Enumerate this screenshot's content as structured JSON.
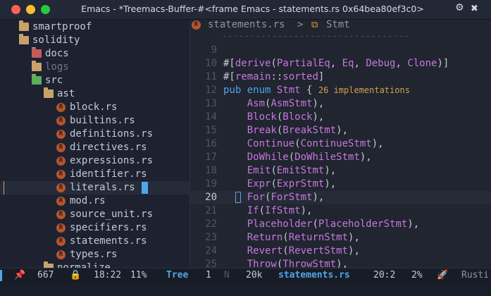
{
  "window": {
    "title": "Emacs - *Treemacs-Buffer-#<frame Emacs - statements.rs 0x64bea80ef3c0>"
  },
  "treemacs": {
    "items": [
      {
        "label": "smartproof",
        "type": "folder",
        "color": "#c9a26a",
        "text_color": "#c3cbd8"
      },
      {
        "label": "solidity",
        "type": "folder",
        "color": "#c9a26a",
        "text_color": "#c3cbd8"
      },
      {
        "label": "docs",
        "type": "folder",
        "color": "#c45c5c",
        "text_color": "#c3cbd8"
      },
      {
        "label": "logs",
        "type": "folder",
        "color": "#c9a26a",
        "text_color": "#6b7a90"
      },
      {
        "label": "src",
        "type": "folder",
        "color": "#5cae5c",
        "text_color": "#c3cbd8"
      },
      {
        "label": "ast",
        "type": "folder",
        "color": "#c9a26a",
        "text_color": "#c3cbd8"
      },
      {
        "label": "block.rs",
        "type": "rust-file",
        "text_color": "#c3cbd8"
      },
      {
        "label": "builtins.rs",
        "type": "rust-file",
        "text_color": "#c3cbd8"
      },
      {
        "label": "definitions.rs",
        "type": "rust-file",
        "text_color": "#c3cbd8"
      },
      {
        "label": "directives.rs",
        "type": "rust-file",
        "text_color": "#c3cbd8"
      },
      {
        "label": "expressions.rs",
        "type": "rust-file",
        "text_color": "#c3cbd8"
      },
      {
        "label": "identifier.rs",
        "type": "rust-file",
        "text_color": "#c3cbd8"
      },
      {
        "label": "literals.rs",
        "type": "rust-file",
        "text_color": "#c3cbd8"
      },
      {
        "label": "mod.rs",
        "type": "rust-file",
        "text_color": "#c3cbd8"
      },
      {
        "label": "source_unit.rs",
        "type": "rust-file",
        "text_color": "#c3cbd8"
      },
      {
        "label": "specifiers.rs",
        "type": "rust-file",
        "text_color": "#c3cbd8"
      },
      {
        "label": "statements.rs",
        "type": "rust-file",
        "text_color": "#c3cbd8"
      },
      {
        "label": "types.rs",
        "type": "rust-file",
        "text_color": "#c3cbd8"
      },
      {
        "label": "normalize",
        "type": "folder",
        "color": "#c9a26a",
        "text_color": "#c3cbd8"
      }
    ]
  },
  "editor": {
    "breadcrumb_file": "statements.rs",
    "breadcrumb_sep": ">",
    "breadcrumb_symbol": "Stmt",
    "dashes": "----------------------------------",
    "lines": [
      {
        "num": "9",
        "parts": []
      },
      {
        "num": "10",
        "parts": [
          {
            "t": "#[",
            "c": "#c3cbd8"
          },
          {
            "t": "derive",
            "c": "#c678dd"
          },
          {
            "t": "(",
            "c": "#c3cbd8"
          },
          {
            "t": "PartialEq",
            "c": "#c678dd"
          },
          {
            "t": ", ",
            "c": "#c3cbd8"
          },
          {
            "t": "Eq",
            "c": "#c678dd"
          },
          {
            "t": ", ",
            "c": "#c3cbd8"
          },
          {
            "t": "Debug",
            "c": "#c678dd"
          },
          {
            "t": ", ",
            "c": "#c3cbd8"
          },
          {
            "t": "Clone",
            "c": "#c678dd"
          },
          {
            "t": ")]",
            "c": "#c3cbd8"
          }
        ]
      },
      {
        "num": "11",
        "parts": [
          {
            "t": "#[",
            "c": "#c3cbd8"
          },
          {
            "t": "remain",
            "c": "#c678dd"
          },
          {
            "t": "::",
            "c": "#c3cbd8"
          },
          {
            "t": "sorted",
            "c": "#c678dd"
          },
          {
            "t": "]",
            "c": "#c3cbd8"
          }
        ]
      },
      {
        "num": "12",
        "parts": [
          {
            "t": "pub ",
            "c": "#4fa6e8"
          },
          {
            "t": "enum ",
            "c": "#4fa6e8"
          },
          {
            "t": "Stmt",
            "c": "#c678dd"
          },
          {
            "t": " { ",
            "c": "#c3cbd8"
          },
          {
            "t": "26 implementations",
            "c": "#d1a14e",
            "small": true
          }
        ]
      },
      {
        "num": "13",
        "parts": [
          {
            "t": "    Asm",
            "c": "#c678dd"
          },
          {
            "t": "(",
            "c": "#c3cbd8"
          },
          {
            "t": "AsmStmt",
            "c": "#c678dd"
          },
          {
            "t": "),",
            "c": "#c3cbd8"
          }
        ]
      },
      {
        "num": "14",
        "parts": [
          {
            "t": "    Block",
            "c": "#c678dd"
          },
          {
            "t": "(",
            "c": "#c3cbd8"
          },
          {
            "t": "Block",
            "c": "#c678dd"
          },
          {
            "t": "),",
            "c": "#c3cbd8"
          }
        ]
      },
      {
        "num": "15",
        "parts": [
          {
            "t": "    Break",
            "c": "#c678dd"
          },
          {
            "t": "(",
            "c": "#c3cbd8"
          },
          {
            "t": "BreakStmt",
            "c": "#c678dd"
          },
          {
            "t": "),",
            "c": "#c3cbd8"
          }
        ]
      },
      {
        "num": "16",
        "parts": [
          {
            "t": "    Continue",
            "c": "#c678dd"
          },
          {
            "t": "(",
            "c": "#c3cbd8"
          },
          {
            "t": "ContinueStmt",
            "c": "#c678dd"
          },
          {
            "t": "),",
            "c": "#c3cbd8"
          }
        ]
      },
      {
        "num": "17",
        "parts": [
          {
            "t": "    DoWhile",
            "c": "#c678dd"
          },
          {
            "t": "(",
            "c": "#c3cbd8"
          },
          {
            "t": "DoWhileStmt",
            "c": "#c678dd"
          },
          {
            "t": "),",
            "c": "#c3cbd8"
          }
        ]
      },
      {
        "num": "18",
        "parts": [
          {
            "t": "    Emit",
            "c": "#c678dd"
          },
          {
            "t": "(",
            "c": "#c3cbd8"
          },
          {
            "t": "EmitStmt",
            "c": "#c678dd"
          },
          {
            "t": "),",
            "c": "#c3cbd8"
          }
        ]
      },
      {
        "num": "19",
        "parts": [
          {
            "t": "    Expr",
            "c": "#c678dd"
          },
          {
            "t": "(",
            "c": "#c3cbd8"
          },
          {
            "t": "ExprStmt",
            "c": "#c678dd"
          },
          {
            "t": "),",
            "c": "#c3cbd8"
          }
        ]
      },
      {
        "num": "20",
        "current": true,
        "parts": [
          {
            "t": "    For",
            "c": "#c678dd"
          },
          {
            "t": "(",
            "c": "#c3cbd8"
          },
          {
            "t": "ForStmt",
            "c": "#c678dd"
          },
          {
            "t": "),",
            "c": "#c3cbd8"
          }
        ]
      },
      {
        "num": "21",
        "parts": [
          {
            "t": "    If",
            "c": "#c678dd"
          },
          {
            "t": "(",
            "c": "#c3cbd8"
          },
          {
            "t": "IfStmt",
            "c": "#c678dd"
          },
          {
            "t": "),",
            "c": "#c3cbd8"
          }
        ]
      },
      {
        "num": "22",
        "parts": [
          {
            "t": "    Placeholder",
            "c": "#c678dd"
          },
          {
            "t": "(",
            "c": "#c3cbd8"
          },
          {
            "t": "PlaceholderStmt",
            "c": "#c678dd"
          },
          {
            "t": "),",
            "c": "#c3cbd8"
          }
        ]
      },
      {
        "num": "23",
        "parts": [
          {
            "t": "    Return",
            "c": "#c678dd"
          },
          {
            "t": "(",
            "c": "#c3cbd8"
          },
          {
            "t": "ReturnStmt",
            "c": "#c678dd"
          },
          {
            "t": "),",
            "c": "#c3cbd8"
          }
        ]
      },
      {
        "num": "24",
        "parts": [
          {
            "t": "    Revert",
            "c": "#c678dd"
          },
          {
            "t": "(",
            "c": "#c3cbd8"
          },
          {
            "t": "RevertStmt",
            "c": "#c678dd"
          },
          {
            "t": "),",
            "c": "#c3cbd8"
          }
        ]
      },
      {
        "num": "25",
        "parts": [
          {
            "t": "    Throw",
            "c": "#c678dd"
          },
          {
            "t": "(",
            "c": "#c3cbd8"
          },
          {
            "t": "ThrowStmt",
            "c": "#c678dd"
          },
          {
            "t": "),",
            "c": "#c3cbd8"
          }
        ]
      }
    ]
  },
  "modeline": {
    "left_lines": "667",
    "time": "18:22",
    "left_pct": "11%",
    "left_buffer": "Tree",
    "right_one": "1",
    "right_n": "N",
    "size": "20k",
    "file": "statements.rs",
    "position": "20:2",
    "pct": "2%",
    "lang": "Rusti"
  }
}
